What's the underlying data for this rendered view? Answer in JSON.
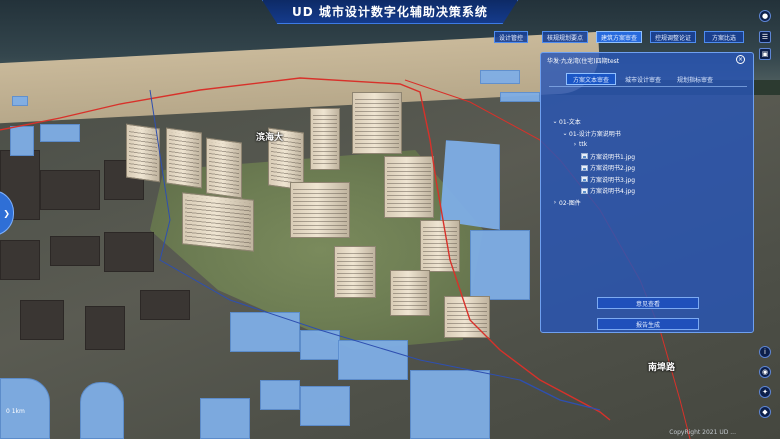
{
  "app": {
    "title": "UD 城市设计数字化辅助决策系统"
  },
  "nav": [
    {
      "label": "设计管控",
      "active": false
    },
    {
      "label": "核规规划要点",
      "active": false
    },
    {
      "label": "建筑方案审查",
      "active": true
    },
    {
      "label": "控规调整论证",
      "active": false
    },
    {
      "label": "方案比选",
      "active": false
    }
  ],
  "panel": {
    "title": "华发·九龙湾(住宅)四期test",
    "close_icon": "close-icon",
    "tabs": [
      {
        "label": "方案文本审查",
        "active": true
      },
      {
        "label": "城市设计审查",
        "active": false
      },
      {
        "label": "规划指标审查",
        "active": false
      }
    ],
    "tree": {
      "folder1": "01-文本",
      "sub1": "01-设计方案说明书",
      "sub2": "ttk",
      "files": [
        "方案说明书1.jpg",
        "方案说明书2.jpg",
        "方案说明书3.jpg",
        "方案说明书4.jpg"
      ],
      "folder2": "02-图件"
    },
    "buttons": {
      "opinion": "意见查看",
      "report": "报告生成"
    }
  },
  "map": {
    "labels": {
      "area": "滨海大",
      "road": "南埠路"
    },
    "copyright": "CopyRight 2021 UD ...",
    "scale": "0 1km"
  },
  "colors": {
    "accent": "#2f6fd6",
    "panel": "#2856b6",
    "boundary": "#d8312a",
    "building_blue": "#7faee6"
  }
}
